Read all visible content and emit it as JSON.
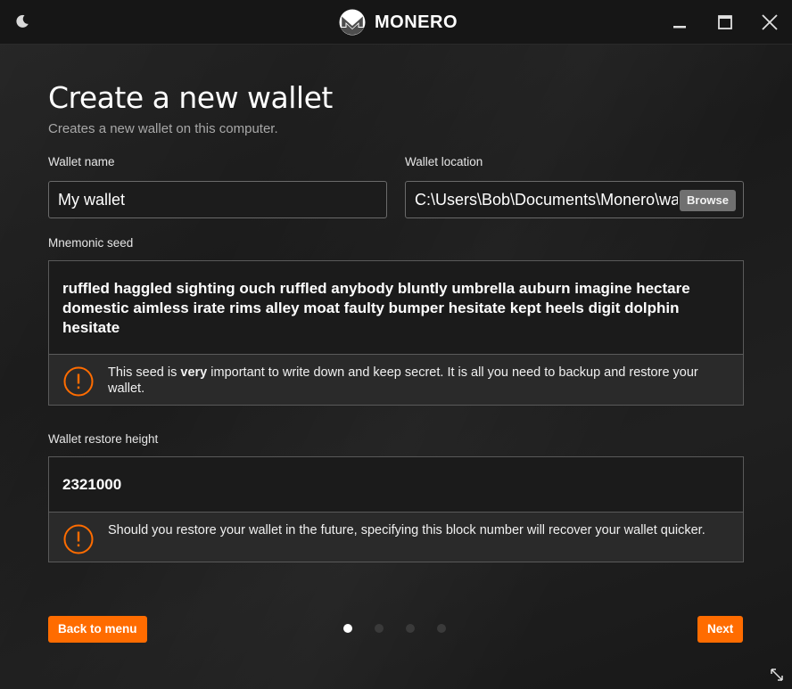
{
  "titlebar": {
    "brand_name": "MONERO",
    "theme_icon": "moon-icon",
    "minimize_icon": "minimize-icon",
    "maximize_icon": "maximize-icon",
    "close_icon": "close-icon"
  },
  "page": {
    "title": "Create a new wallet",
    "subtitle": "Creates a new wallet on this computer."
  },
  "wallet_name": {
    "label": "Wallet name",
    "value": "My wallet"
  },
  "wallet_location": {
    "label": "Wallet location",
    "value": "C:\\Users\\Bob\\Documents\\Monero\\wallets",
    "browse_label": "Browse"
  },
  "mnemonic": {
    "label": "Mnemonic seed",
    "seed": "ruffled haggled sighting ouch ruffled anybody bluntly umbrella auburn imagine hectare domestic aimless irate rims alley moat faulty bumper hesitate kept heels digit dolphin hesitate",
    "warning_before": "This seed is ",
    "warning_bold": "very",
    "warning_after": " important to write down and keep secret. It is all you need to backup and restore your wallet."
  },
  "restore_height": {
    "label": "Wallet restore height",
    "value": "2321000",
    "warning": "Should you restore your wallet in the future, specifying this block number will recover your wallet quicker."
  },
  "nav": {
    "back_label": "Back to menu",
    "next_label": "Next",
    "steps_total": 4,
    "current_step": 1
  },
  "colors": {
    "accent": "#ff6c00",
    "background": "#1c1c1c"
  }
}
